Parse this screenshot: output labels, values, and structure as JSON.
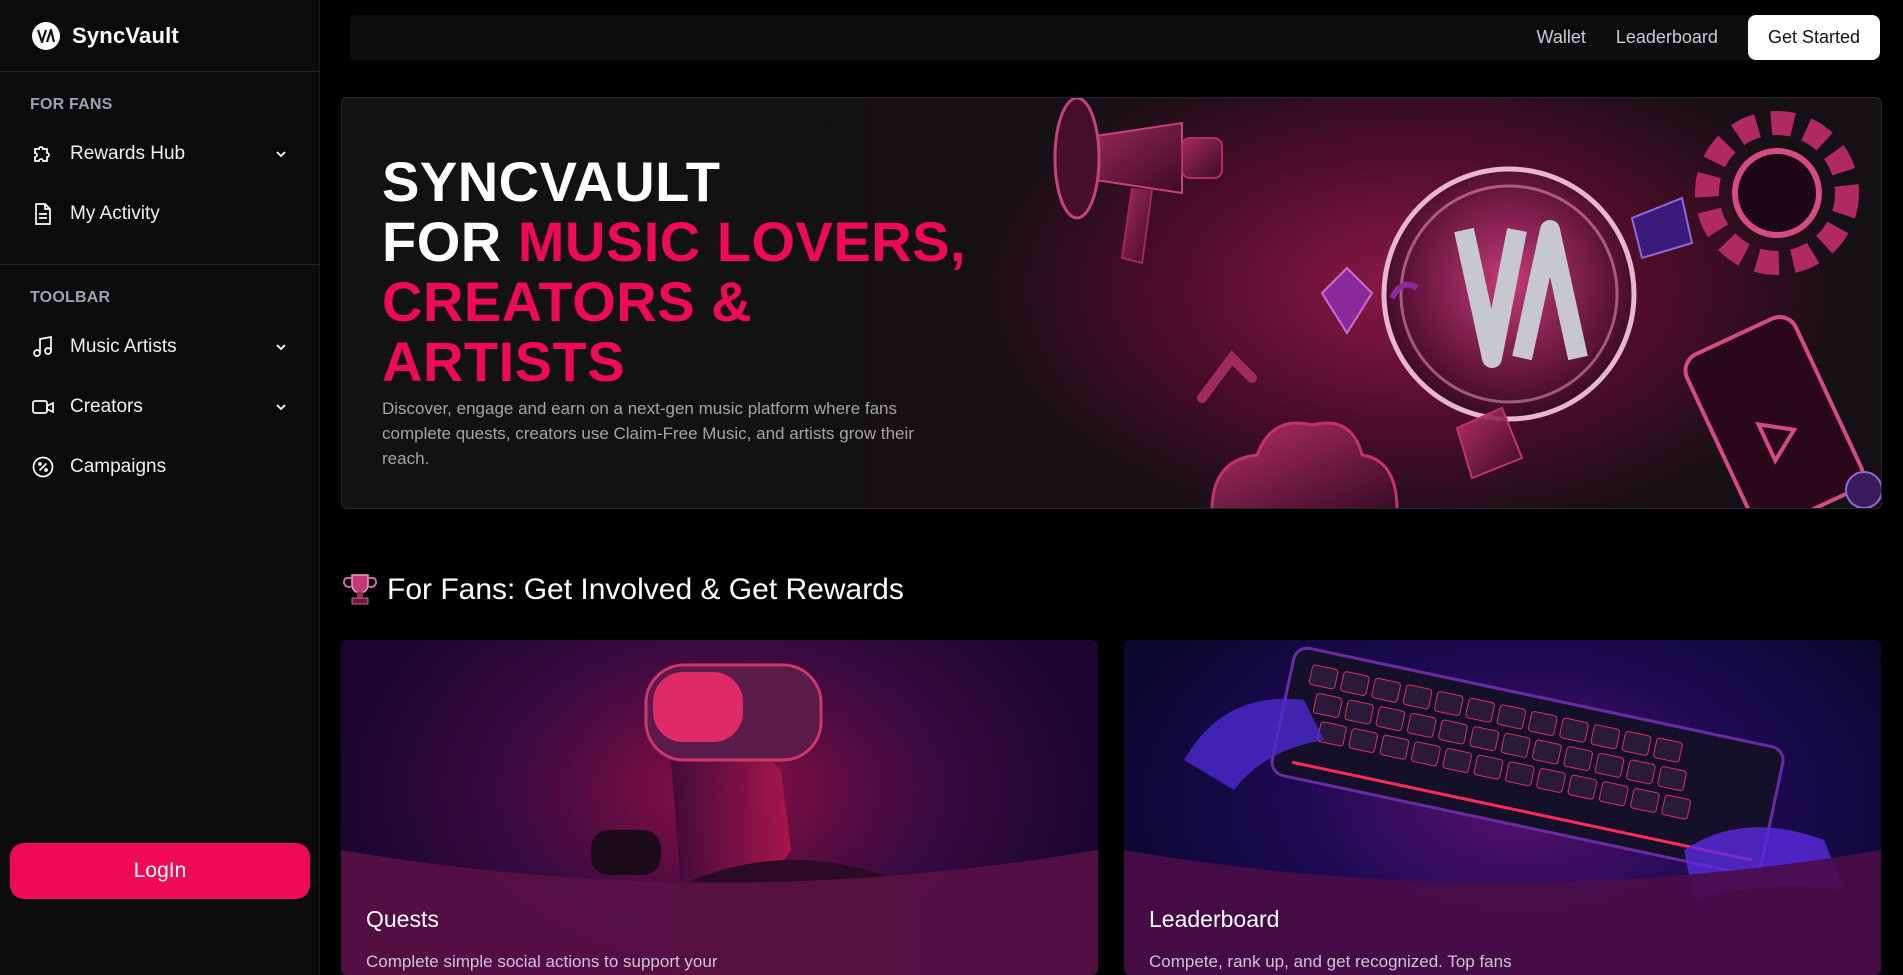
{
  "brand": {
    "name": "SyncVault",
    "logo_icon": "syncvault-logo-icon"
  },
  "sidebar": {
    "sections": [
      {
        "label": "FOR FANS",
        "items": [
          {
            "label": "Rewards Hub",
            "icon": "puzzle-icon",
            "has_submenu": true
          },
          {
            "label": "My Activity",
            "icon": "document-icon",
            "has_submenu": false
          }
        ]
      },
      {
        "label": "TOOLBAR",
        "items": [
          {
            "label": "Music Artists",
            "icon": "music-note-icon",
            "has_submenu": true
          },
          {
            "label": "Creators",
            "icon": "video-camera-icon",
            "has_submenu": true
          },
          {
            "label": "Campaigns",
            "icon": "badge-percent-icon",
            "has_submenu": false
          }
        ]
      }
    ],
    "login_label": "LogIn"
  },
  "topbar": {
    "links": [
      "Wallet",
      "Leaderboard"
    ],
    "cta_label": "Get Started"
  },
  "hero": {
    "title_line1": "SYNCVAULT",
    "title_line2_white": "FOR ",
    "title_line2_pink": "MUSIC LOVERS,",
    "title_line3": "CREATORS &",
    "title_line4": "ARTISTS",
    "description": "Discover, engage and earn on a next-gen music platform where fans complete quests, creators use Claim-Free Music, and artists grow their reach."
  },
  "fans_section": {
    "icon": "trophy-icon",
    "title": "For Fans: Get Involved & Get Rewards",
    "cards": [
      {
        "title": "Quests",
        "description": "Complete simple social actions to support your"
      },
      {
        "title": "Leaderboard",
        "description": "Compete, rank up, and get recognized. Top fans"
      }
    ]
  },
  "colors": {
    "accent": "#ee0a55",
    "background": "#000000",
    "sidebar": "#0b0b0b"
  }
}
